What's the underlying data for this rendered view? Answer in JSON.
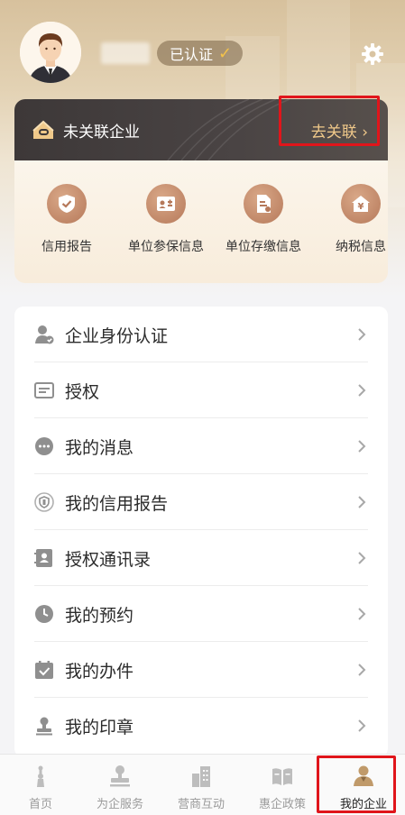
{
  "profile": {
    "verified_label": "已认证",
    "verified_mark": "✓",
    "settings_icon": "gear-icon",
    "avatar_icon": "avatar-icon"
  },
  "enterprise": {
    "status_text": "未关联企业",
    "link_label": "去关联 ›",
    "icon": "house-link-icon",
    "quick_actions": [
      {
        "label": "信用报告",
        "icon": "shield-check-icon"
      },
      {
        "label": "单位参保信息",
        "icon": "id-card-icon"
      },
      {
        "label": "单位存缴信息",
        "icon": "document-icon"
      },
      {
        "label": "纳税信息",
        "icon": "yuan-house-icon"
      }
    ]
  },
  "menu": {
    "items": [
      {
        "label": "企业身份认证",
        "icon": "user-verify-icon"
      },
      {
        "label": "授权",
        "icon": "authorize-icon"
      },
      {
        "label": "我的消息",
        "icon": "message-icon"
      },
      {
        "label": "我的信用报告",
        "icon": "credit-report-icon"
      },
      {
        "label": "授权通讯录",
        "icon": "contacts-icon"
      },
      {
        "label": "我的预约",
        "icon": "clock-icon"
      },
      {
        "label": "我的办件",
        "icon": "calendar-check-icon"
      },
      {
        "label": "我的印章",
        "icon": "seal-icon"
      }
    ]
  },
  "tabbar": {
    "tabs": [
      {
        "label": "首页",
        "icon": "home-tower-icon",
        "active": false
      },
      {
        "label": "为企服务",
        "icon": "service-stamp-icon",
        "active": false
      },
      {
        "label": "营商互动",
        "icon": "buildings-icon",
        "active": false
      },
      {
        "label": "惠企政策",
        "icon": "policy-book-icon",
        "active": false
      },
      {
        "label": "我的企业",
        "icon": "my-enterprise-icon",
        "active": true
      }
    ]
  },
  "colors": {
    "accent_gold": "#f0c98a",
    "dark_bar": "#3d3838",
    "icon_brown": "#b6795a",
    "highlight_red": "#e0151b"
  }
}
